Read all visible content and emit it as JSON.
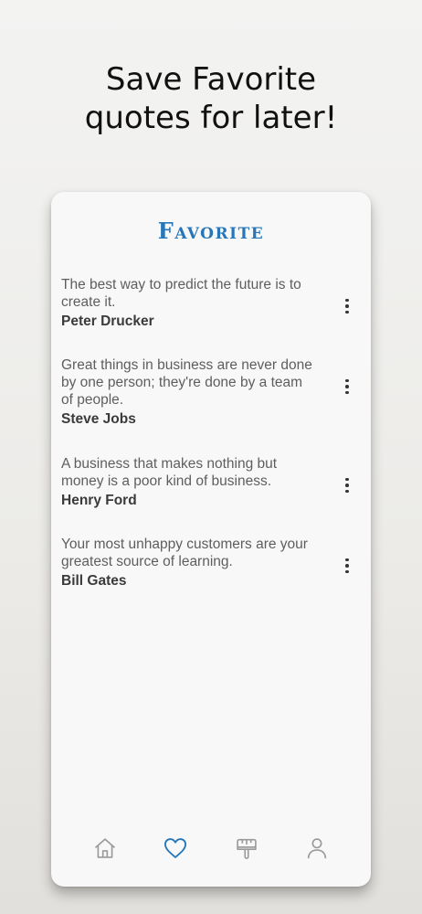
{
  "headline": {
    "line1": "Save Favorite",
    "line2": "quotes for later!"
  },
  "screen": {
    "title": "Favorite"
  },
  "quotes": [
    {
      "text": "The best way to predict the future is to create it.",
      "author": "Peter Drucker"
    },
    {
      "text": "Great things in business are never done by one person; they're done by a team of people.",
      "author": "Steve Jobs"
    },
    {
      "text": "A business that makes nothing but money is a poor kind of business.",
      "author": "Henry Ford"
    },
    {
      "text": "Your most unhappy customers are your greatest source of learning.",
      "author": "Bill Gates"
    }
  ],
  "nav": {
    "items": [
      {
        "icon": "home-icon",
        "active": false
      },
      {
        "icon": "heart-icon",
        "active": true
      },
      {
        "icon": "paint-brush-icon",
        "active": false
      },
      {
        "icon": "user-icon",
        "active": false
      }
    ],
    "active_color": "#2676b9",
    "inactive_color": "#9a9a9a"
  },
  "colors": {
    "title": "#2676b9",
    "quote_text": "#5e5e5e",
    "author": "#3a3a3a"
  }
}
